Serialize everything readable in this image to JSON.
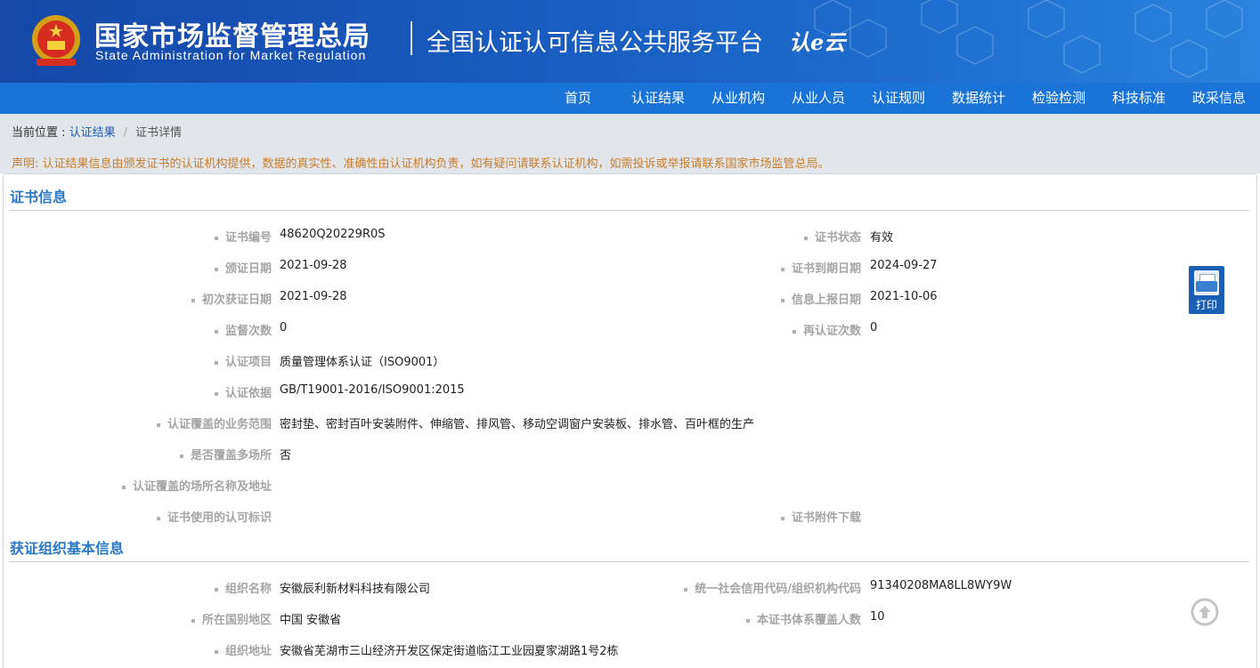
{
  "header": {
    "title_cn": "国家市场监督管理总局",
    "title_en": "State Administration  for  Market Regulation",
    "platform": "全国认证认可信息公共服务平台",
    "logo_text": "认e云"
  },
  "nav": [
    "首页",
    "认证结果",
    "从业机构",
    "从业人员",
    "认证规则",
    "数据统计",
    "检验检测",
    "科技标准",
    "政采信息"
  ],
  "breadcrumb": {
    "prefix": "当前位置 : ",
    "link": "认证结果",
    "sep": "/",
    "current": "证书详情"
  },
  "notice": "声明: 认证结果信息由颁发证书的认证机构提供，数据的真实性、准确性由认证机构负责，如有疑问请联系认证机构，如需投诉或举报请联系国家市场监管总局。",
  "cert": {
    "title": "证书信息",
    "fields": {
      "cert_no": {
        "label": "证书编号",
        "value": "48620Q20229R0S"
      },
      "status": {
        "label": "证书状态",
        "value": "有效"
      },
      "issue_date": {
        "label": "颁证日期",
        "value": "2021-09-28"
      },
      "expiry_date": {
        "label": "证书到期日期",
        "value": "2024-09-27"
      },
      "first_date": {
        "label": "初次获证日期",
        "value": "2021-09-28"
      },
      "report_date": {
        "label": "信息上报日期",
        "value": "2021-10-06"
      },
      "supervision_count": {
        "label": "监督次数",
        "value": "0"
      },
      "recert_count": {
        "label": "再认证次数",
        "value": "0"
      },
      "project": {
        "label": "认证项目",
        "value": "质量管理体系认证（ISO9001）"
      },
      "basis": {
        "label": "认证依据",
        "value": "GB/T19001-2016/ISO9001:2015"
      },
      "scope": {
        "label": "认证覆盖的业务范围",
        "value": "密封垫、密封百叶安装附件、伸缩管、排风管、移动空调窗户安装板、排水管、百叶框的生产"
      },
      "multi_site": {
        "label": "是否覆盖多场所",
        "value": "否"
      },
      "sites": {
        "label": "认证覆盖的场所名称及地址",
        "value": ""
      },
      "accred_mark": {
        "label": "证书使用的认可标识",
        "value": ""
      },
      "attachment": {
        "label": "证书附件下载",
        "value": ""
      }
    }
  },
  "org": {
    "title": "获证组织基本信息",
    "fields": {
      "name": {
        "label": "组织名称",
        "value": "安徽辰利新材料科技有限公司"
      },
      "credit_code": {
        "label": "统一社会信用代码/组织机构代码",
        "value": "91340208MA8LL8WY9W"
      },
      "region": {
        "label": "所在国别地区",
        "value": "中国 安徽省"
      },
      "covered": {
        "label": "本证书体系覆盖人数",
        "value": "10"
      },
      "address": {
        "label": "组织地址",
        "value": "安徽省芜湖市三山经济开发区保定街道临江工业园夏家湖路1号2栋"
      }
    }
  },
  "print_label": "打印",
  "colors": {
    "header": "#1a5cc0",
    "nav": "#1a73d6",
    "accent": "#2b78c5",
    "notice": "#c87f2d"
  }
}
